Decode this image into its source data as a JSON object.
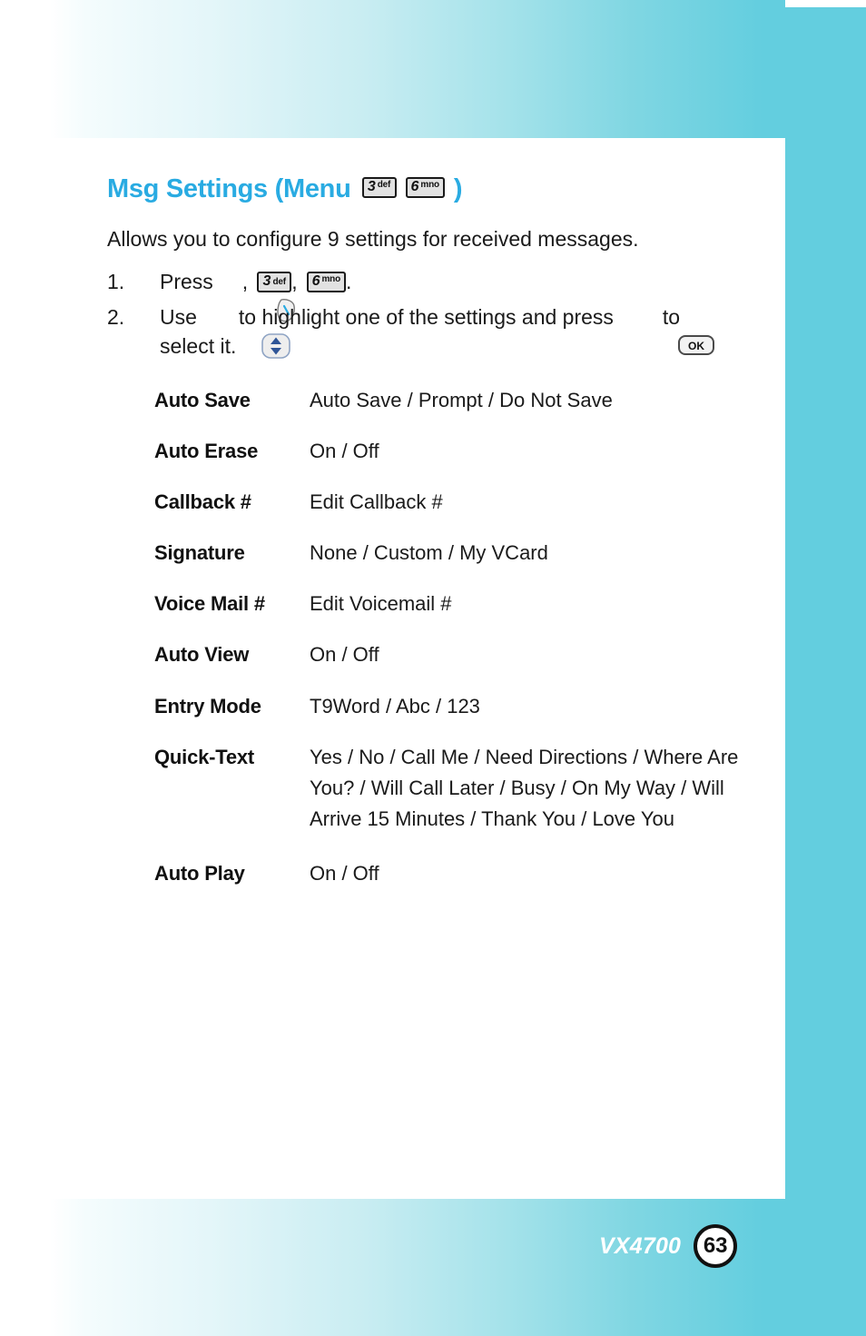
{
  "page": {
    "accent_color": "#29abe2",
    "band_color": "#63cedf",
    "heading_prefix": "Msg Settings (Menu",
    "heading_suffix": ")"
  },
  "heading_keys": [
    {
      "digit": "3",
      "letters": "def"
    },
    {
      "digit": "6",
      "letters": "mno"
    }
  ],
  "intro": "Allows you to configure 9 settings for received messages.",
  "steps": [
    {
      "number": "1.",
      "before": "Press",
      "icon": "send-key-icon",
      "comma1": ",",
      "keys": [
        {
          "digit": "3",
          "letters": "def"
        },
        {
          "digit": "6",
          "letters": "mno"
        }
      ],
      "comma2": ",",
      "after": "."
    },
    {
      "number": "2.",
      "before": "Use",
      "icon": "nav-updown-key-icon",
      "middle": "to highlight one of the settings and press",
      "ok_label": "OK",
      "after": "to",
      "line2": "select it."
    }
  ],
  "settings": [
    {
      "label": "Auto Save",
      "value": "Auto Save / Prompt / Do Not Save"
    },
    {
      "label": "Auto Erase",
      "value": "On / Off"
    },
    {
      "label": "Callback #",
      "value": "Edit Callback #"
    },
    {
      "label": "Signature",
      "value": "None / Custom / My VCard"
    },
    {
      "label": "Voice Mail #",
      "value": "Edit Voicemail #"
    },
    {
      "label": "Auto View",
      "value": "On / Off"
    },
    {
      "label": "Entry Mode",
      "value": "T9Word / Abc / 123"
    },
    {
      "label": "Quick-Text",
      "value": "Yes / No / Call Me / Need Directions / Where Are You? / Will Call Later / Busy / On My Way / Will Arrive 15 Minutes / Thank You / Love You"
    },
    {
      "label": "Auto Play",
      "value": "On / Off"
    }
  ],
  "footer": {
    "model": "VX4700",
    "page_number": "63"
  }
}
